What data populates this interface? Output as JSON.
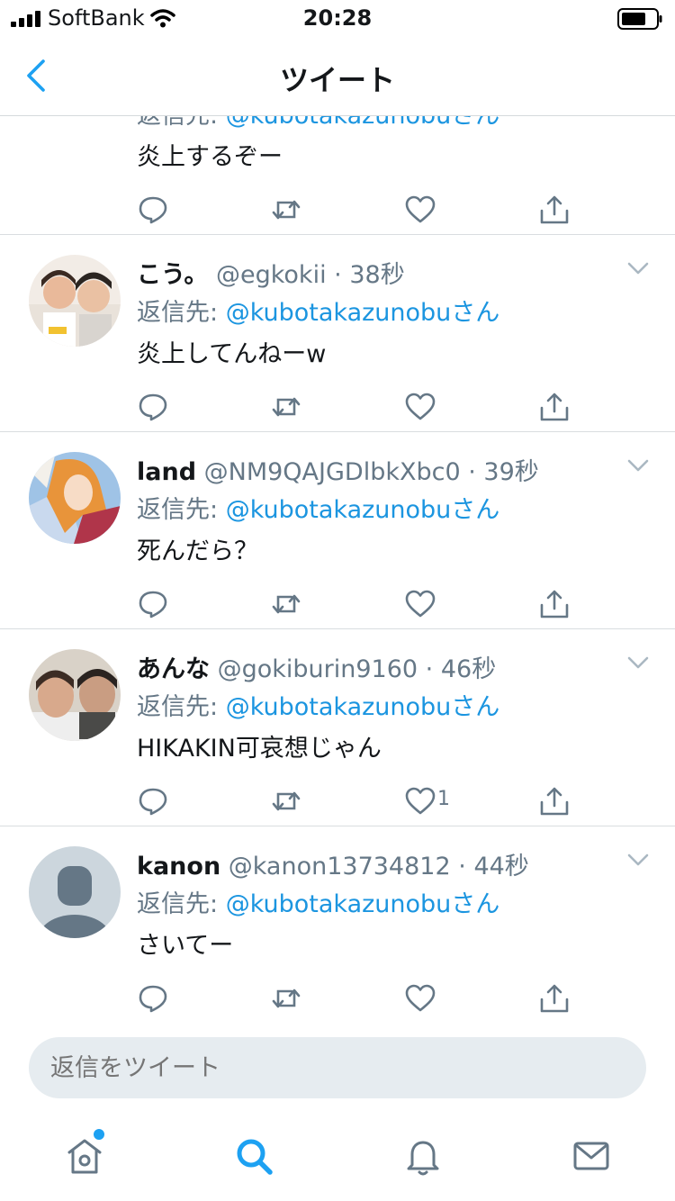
{
  "status": {
    "carrier": "SoftBank",
    "time": "20:28"
  },
  "nav": {
    "title": "ツイート"
  },
  "reply_prefix": "返信先:",
  "tweets": [
    {
      "name": "",
      "handle": "",
      "dot": "",
      "time": "",
      "reply_to": "@kubotakazunobuさん",
      "text": "炎上するぞー",
      "likes": ""
    },
    {
      "name": "こう。",
      "handle": "@egkokii",
      "dot": "·",
      "time": "38秒",
      "reply_to": "@kubotakazunobuさん",
      "text": "炎上してんねーw",
      "likes": ""
    },
    {
      "name": "land",
      "handle": "@NM9QAJGDlbkXbc0",
      "dot": "·",
      "time": "39秒",
      "reply_to": "@kubotakazunobuさん",
      "text": "死んだら？",
      "likes": ""
    },
    {
      "name": "あんな",
      "handle": "@gokiburin9160",
      "dot": "·",
      "time": "46秒",
      "reply_to": "@kubotakazunobuさん",
      "text": "HIKAKIN可哀想じゃん",
      "likes": "1"
    },
    {
      "name": "kanon",
      "handle": "@kanon13734812",
      "dot": "·",
      "time": "44秒",
      "reply_to": "@kubotakazunobuさん",
      "text": "さいてー",
      "likes": ""
    }
  ],
  "reply_bar": {
    "placeholder": "返信をツイート"
  },
  "tabs": {
    "active": "search",
    "home_has_dot": true
  },
  "colors": {
    "accent": "#1da1f2",
    "link": "#1b95e0",
    "muted": "#657786",
    "icon": "#657786"
  }
}
